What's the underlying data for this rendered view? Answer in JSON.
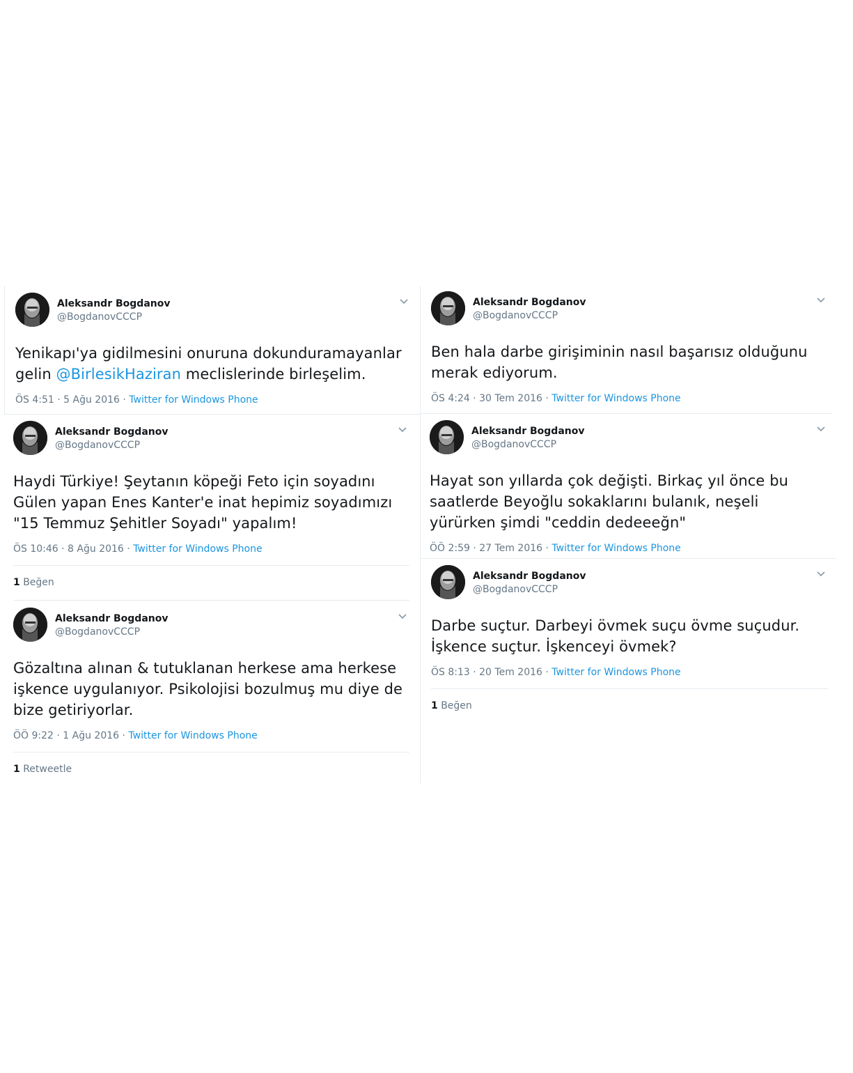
{
  "tweets": [
    {
      "name": "Aleksandr Bogdanov",
      "handle": "@BogdanovCCCP",
      "text_pre": "Yenikapı'ya gidilmesini onuruna dokunduramayanlar gelin ",
      "mention": "@BirlesikHaziran",
      "text_post": " meclislerinde birleşelim.",
      "time": "ÖS 4:51 · 5 Ağu 2016 · ",
      "source": "Twitter for Windows Phone"
    },
    {
      "name": "Aleksandr Bogdanov",
      "handle": "@BogdanovCCCP",
      "text": "Ben hala darbe girişiminin nasıl başarısız olduğunu merak ediyorum.",
      "time": "ÖS 4:24 · 30 Tem 2016 · ",
      "source": "Twitter for Windows Phone"
    },
    {
      "name": "Aleksandr Bogdanov",
      "handle": "@BogdanovCCCP",
      "text": "Haydi Türkiye! Şeytanın köpeği Feto için soyadını Gülen yapan Enes Kanter'e inat hepimiz soyadımızı \"15 Temmuz Şehitler Soyadı\" yapalım!",
      "time": "ÖS 10:46 · 8 Ağu 2016 · ",
      "source": "Twitter for Windows Phone",
      "stat_count": "1",
      "stat_label": " Beğen"
    },
    {
      "name": "Aleksandr Bogdanov",
      "handle": "@BogdanovCCCP",
      "text": "Hayat son yıllarda çok değişti. Birkaç yıl önce bu saatlerde Beyoğlu sokaklarını bulanık, neşeli yürürken şimdi \"ceddin dedeeeğn\"",
      "time": "ÖÖ 2:59 · 27 Tem 2016 · ",
      "source": "Twitter for Windows Phone"
    },
    {
      "name": "Aleksandr Bogdanov",
      "handle": "@BogdanovCCCP",
      "text": "Gözaltına alınan & tutuklanan herkese ama herkese işkence uygulanıyor. Psikolojisi bozulmuş mu diye de bize getiriyorlar.",
      "time": "ÖÖ 9:22 · 1 Ağu 2016 · ",
      "source": "Twitter for Windows Phone",
      "stat_count": "1",
      "stat_label": " Retweetle"
    },
    {
      "name": "Aleksandr Bogdanov",
      "handle": "@BogdanovCCCP",
      "text": "Darbe suçtur. Darbeyi övmek suçu övme suçudur. İşkence suçtur. İşkenceyi övmek?",
      "time": "ÖS 8:13 · 20 Tem 2016 · ",
      "source": "Twitter for Windows Phone",
      "stat_count": "1",
      "stat_label": " Beğen"
    }
  ],
  "icons": {
    "avatar": "profile-photo",
    "menu": "chevron-down-icon"
  },
  "colors": {
    "link": "#1b95e0",
    "meta": "#657786",
    "text": "#14171a",
    "divider": "#e6ecf0"
  }
}
